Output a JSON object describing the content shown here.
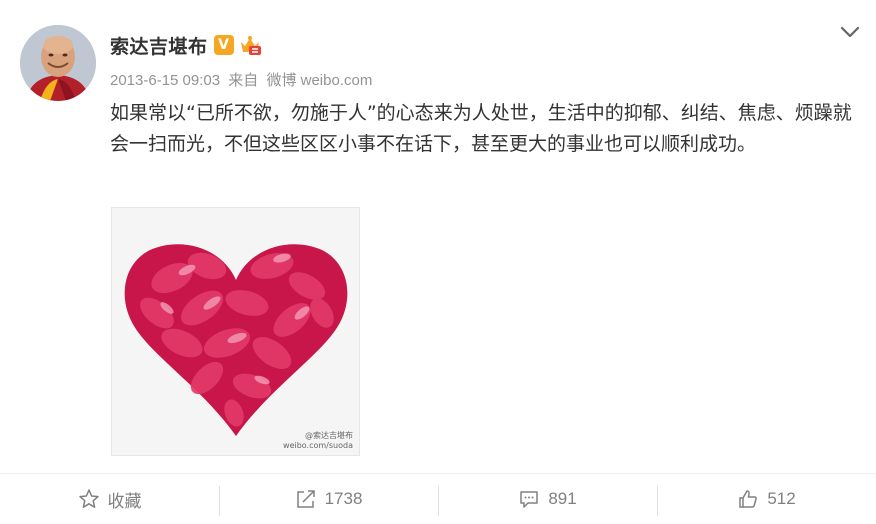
{
  "post": {
    "user": {
      "name": "索达吉堪布",
      "avatar_icon": "monk-avatar",
      "verified_badge": "V",
      "badges": [
        "verified-v-icon",
        "crown-badge-icon"
      ]
    },
    "meta": {
      "date": "2013-6-15 09:03",
      "source_prefix": "来自",
      "source": "微博 weibo.com"
    },
    "text": "如果常以“已所不欲，勿施于人”的心态来为人处世，生活中的抑郁、纠结、焦虑、烦躁就会一扫而光，不但这些区区小事不在话下，甚至更大的事业也可以顺利成功。",
    "image": {
      "description_icon": "rose-petal-heart-image",
      "watermark_line1": "@索达吉堪布",
      "watermark_line2": "weibo.com/suoda"
    }
  },
  "actions": {
    "favorite": {
      "label": "收藏",
      "icon": "star-icon"
    },
    "repost": {
      "count": "1738",
      "icon": "share-arrow-icon"
    },
    "comment": {
      "count": "891",
      "icon": "comment-icon"
    },
    "like": {
      "count": "512",
      "icon": "thumbs-up-icon"
    }
  },
  "colors": {
    "text": "#333333",
    "meta": "#939393",
    "action": "#808080",
    "badge_orange": "#f5a623",
    "petal_red": "#d81b4f"
  }
}
